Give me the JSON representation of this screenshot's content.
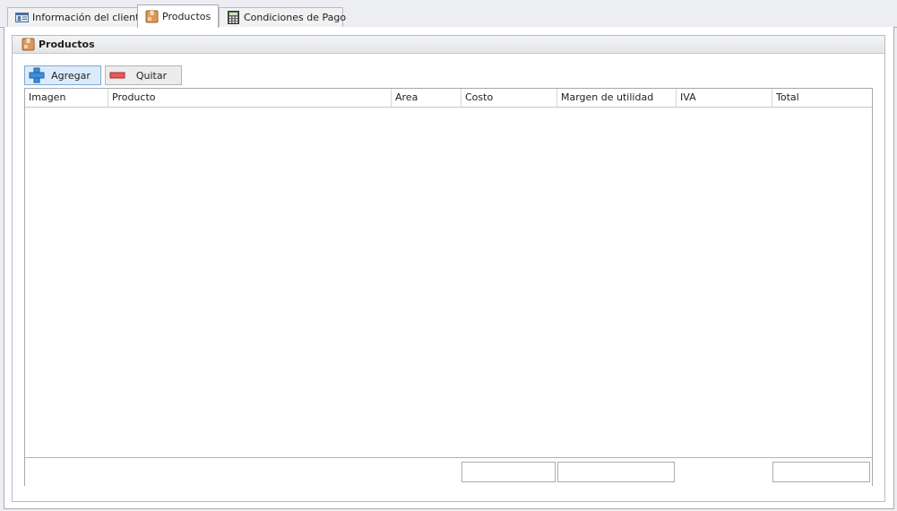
{
  "tabs": [
    {
      "label": "Información del cliente",
      "icon": "id-card-icon",
      "active": false
    },
    {
      "label": "Productos",
      "icon": "package-icon",
      "active": true
    },
    {
      "label": "Condiciones de Pago",
      "icon": "calculator-icon",
      "active": false
    }
  ],
  "group": {
    "title": "Productos",
    "icon": "package-icon"
  },
  "toolbar": {
    "add_label": "Agregar",
    "remove_label": "Quitar"
  },
  "grid": {
    "columns": [
      "Imagen",
      "Producto",
      "Area",
      "Costo",
      "Margen de utilidad",
      "IVA",
      "Total"
    ],
    "rows": [],
    "summary": {
      "costo": "",
      "margen": "",
      "total": ""
    }
  },
  "colors": {
    "accent": "#dcebfa",
    "border": "#a9acb1"
  }
}
